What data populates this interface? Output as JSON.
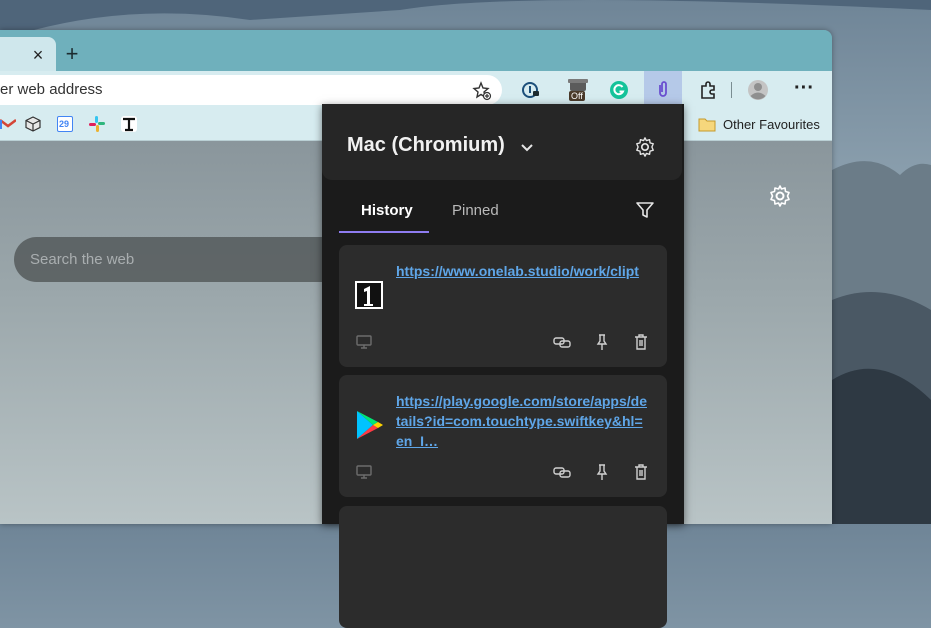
{
  "browser": {
    "tab_close_glyph": "×",
    "new_tab_glyph": "+",
    "address_placeholder": "er web address",
    "extension_badge": "Off",
    "menu_glyph": "···",
    "other_favourites_label": "Other Favourites",
    "calendar_day": "29"
  },
  "page": {
    "search_placeholder": "Search the web"
  },
  "popup": {
    "device_name": "Mac (Chromium)",
    "tabs": [
      {
        "label": "History",
        "active": true
      },
      {
        "label": "Pinned",
        "active": false
      }
    ],
    "cards": [
      {
        "url": "https://www.onelab.studio/work/clipt",
        "thumb": "onelab-logo-icon"
      },
      {
        "url": "https://play.google.com/store/apps/details?id=com.touchtype.swiftkey&hl=en_I…",
        "thumb": "google-play-icon"
      }
    ]
  },
  "colors": {
    "tab_active_underline": "#8e7cf0",
    "link": "#5fa6e8",
    "popup_bg": "#1b1b1b",
    "card_bg": "#2c2c2c"
  }
}
